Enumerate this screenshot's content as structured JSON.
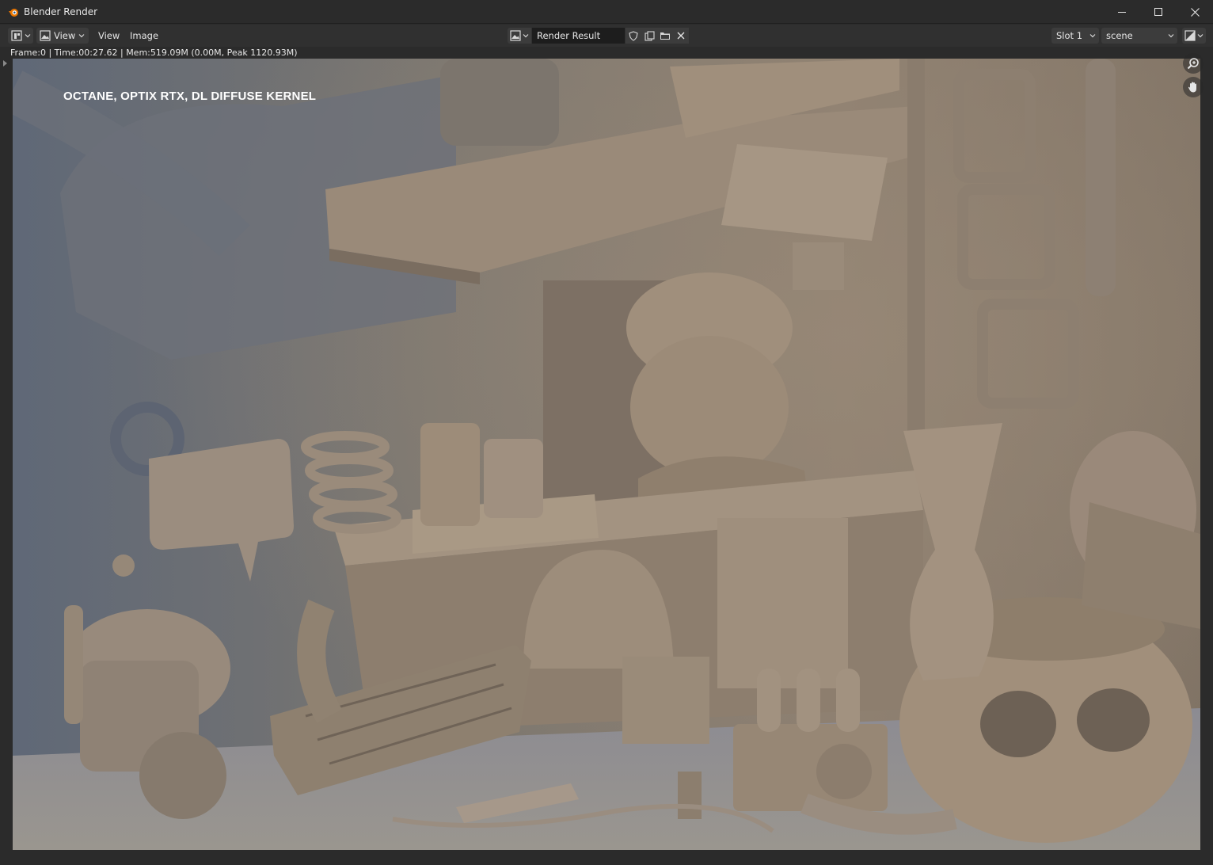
{
  "window": {
    "title": "Blender Render",
    "controls": [
      "minimize-icon",
      "maximize-icon",
      "close-icon"
    ]
  },
  "header": {
    "editor_type_icon": "image-editor-icon",
    "view_dropdown_label": "View",
    "menus": [
      "View",
      "Image"
    ],
    "image_name": "Render Result",
    "image_buttons": [
      "fake-user-shield-icon",
      "new-image-icon",
      "open-folder-icon",
      "close-icon"
    ],
    "slot": "Slot 1",
    "scene": "scene",
    "display_mode_icon": "display-channels-icon"
  },
  "status": {
    "text": "Frame:0 | Time:00:27.62 | Mem:519.09M (0.00M, Peak 1120.93M)"
  },
  "viewport": {
    "overlay_label": "OCTANE, OPTIX RTX, DL DIFFUSE KERNEL",
    "gizmos": [
      "zoom-icon",
      "pan-hand-icon"
    ]
  },
  "colors": {
    "titlebar": "#2b2b2b",
    "header": "#303030",
    "button": "#3c3c3c",
    "field": "#1d1d1d",
    "render_warm": "#8e7f6e",
    "render_cool": "#6b7180"
  }
}
